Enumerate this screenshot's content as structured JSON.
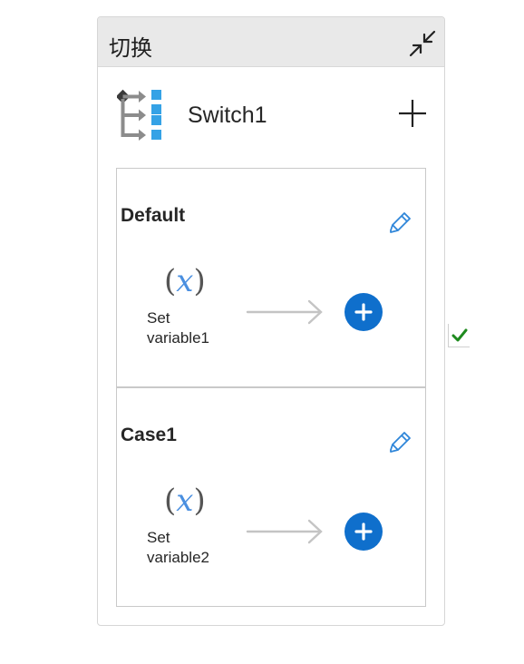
{
  "panel": {
    "title": "切换",
    "collapse_icon": "collapse-arrows-icon"
  },
  "switch": {
    "name": "Switch1",
    "icon": "switch-icon",
    "add_icon": "plus-icon"
  },
  "cases": [
    {
      "title": "Default",
      "edit_icon": "pencil-icon",
      "action": {
        "icon": "variable-icon",
        "icon_text": "(",
        "icon_var": "x",
        "icon_close": ")",
        "label_line1": "Set",
        "label_line2": "variable1"
      }
    },
    {
      "title": "Case1",
      "edit_icon": "pencil-icon",
      "action": {
        "icon": "variable-icon",
        "icon_text": "(",
        "icon_var": "x",
        "icon_close": ")",
        "label_line1": "Set",
        "label_line2": "variable2"
      }
    }
  ],
  "colors": {
    "accent_blue": "#0f6fcc",
    "variable_blue": "#4a8fe0",
    "check_green": "#1e8a1e",
    "header_bg": "#e9e9e9"
  },
  "status_icon": "checkmark-icon"
}
